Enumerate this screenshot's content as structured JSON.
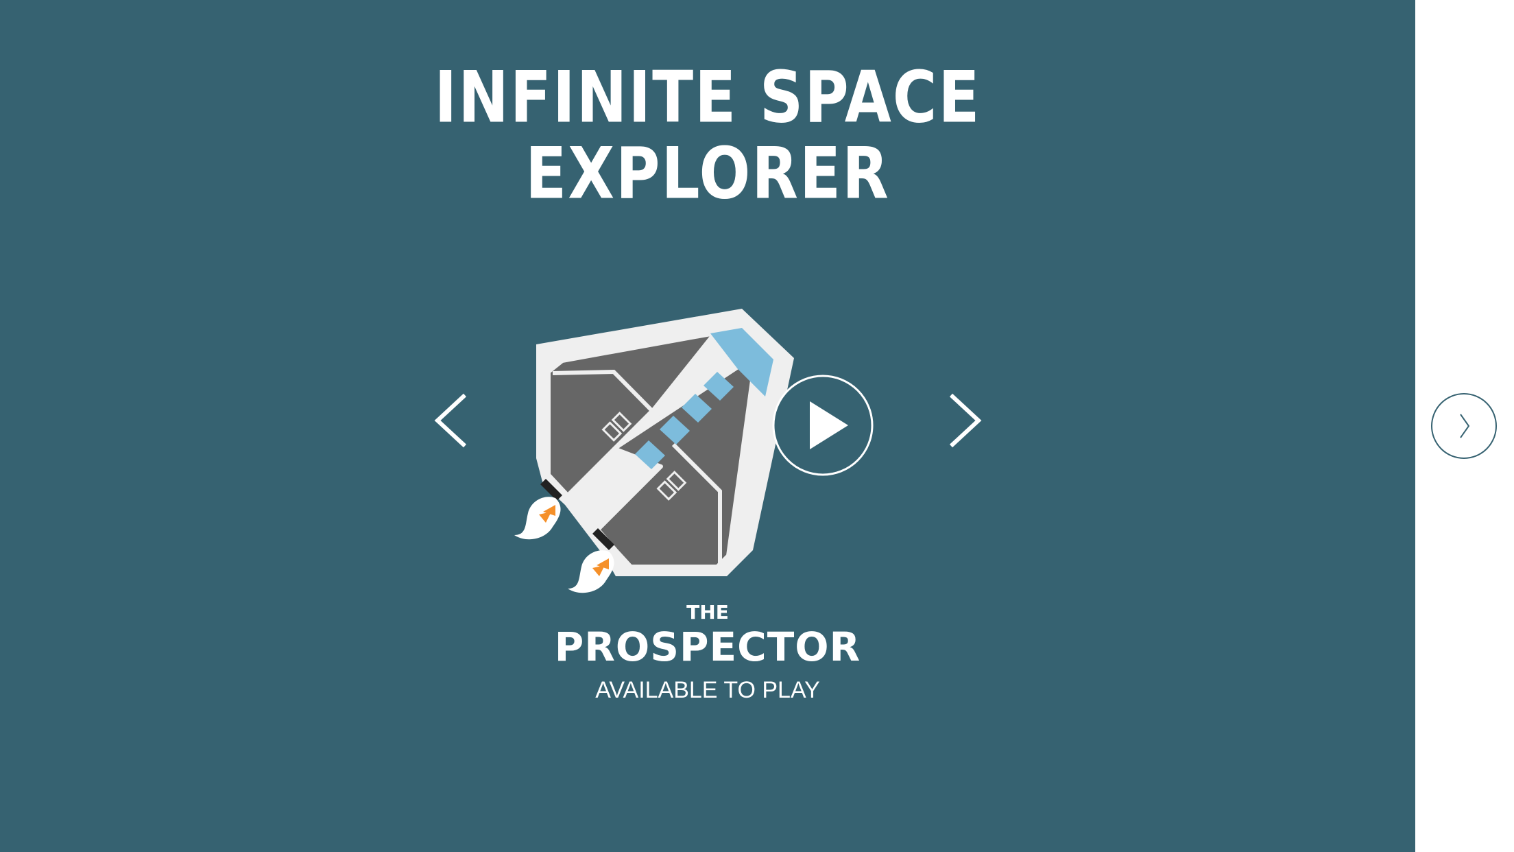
{
  "title": {
    "line1": "INFINITE SPACE",
    "line2": "EXPLORER"
  },
  "ship": {
    "prefix": "THE",
    "name": "PROSPECTOR",
    "status": "AVAILABLE TO PLAY"
  },
  "colors": {
    "background": "#366271",
    "hull": "#666666",
    "hull_outline": "#efefef",
    "window": "#7dbcdc",
    "thruster_flame": "#f5902a",
    "side_button": "#366271"
  },
  "icons": {
    "prev": "chevron-left-icon",
    "next": "chevron-right-icon",
    "play": "play-icon",
    "side_next": "chevron-right-icon"
  }
}
